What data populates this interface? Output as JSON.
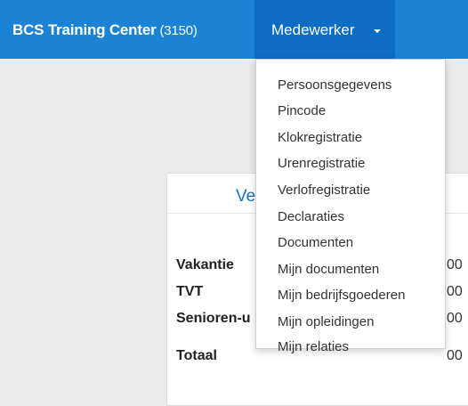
{
  "navbar": {
    "brand": "BCS Training Center",
    "brand_code": "(3150)",
    "dropdown_label": "Medewerker",
    "accent_color": "#1b83d6",
    "active_color": "#0d6cc3"
  },
  "card": {
    "title_partial": "Ve",
    "rows": [
      {
        "label": "Vakantie",
        "value": "00"
      },
      {
        "label": "TVT",
        "value": "00"
      },
      {
        "label": "Senioren-u",
        "value": "00"
      },
      {
        "label": "Totaal",
        "value": "00"
      }
    ]
  },
  "menu": {
    "items": [
      "Persoonsgegevens",
      "Pincode",
      "Klokregistratie",
      "Urenregistratie",
      "Verlofregistratie",
      "Declaraties",
      "Documenten",
      "Mijn documenten",
      "Mijn bedrijfsgoederen",
      "Mijn opleidingen",
      "Mijn relaties"
    ]
  }
}
